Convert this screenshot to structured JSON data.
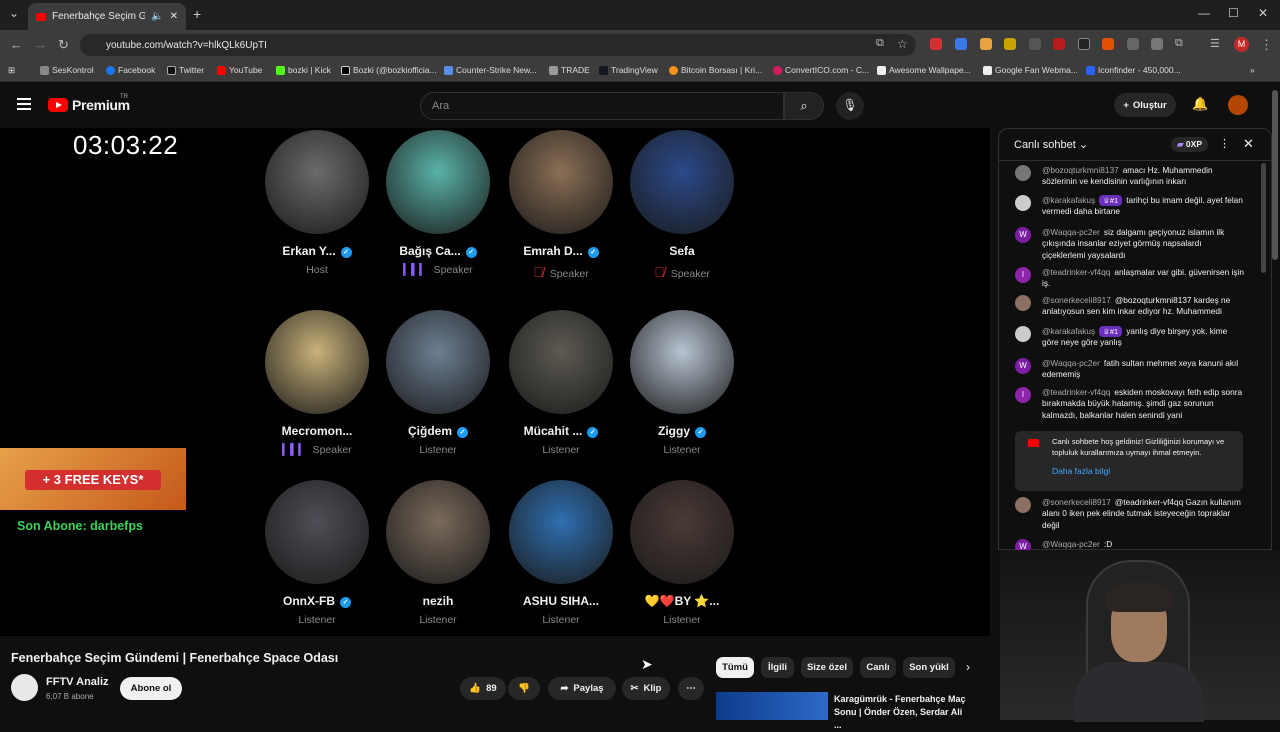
{
  "browser": {
    "tab_title": "Fenerbahçe Seçim Gündem",
    "url": "youtube.com/watch?v=hlkQLk6UpTI",
    "profile_initial": "M",
    "bookmarks": [
      "SesKontrol",
      "Facebook",
      "Twitter",
      "YouTube",
      "bozki | Kick",
      "Bozki (@bozkiofficia...",
      "Counter-Strike New...",
      "TRADE",
      "TradingView",
      "Bitcoin Borsası | Kri...",
      "ConvertICO.com - C...",
      "Awesome Wallpape...",
      "Google Fan Webma...",
      "Iconfinder - 450,000..."
    ]
  },
  "header": {
    "logo_text": "Premium",
    "logo_country": "TR",
    "search_placeholder": "Ara",
    "create_label": "Oluştur"
  },
  "player": {
    "timer": "03:03:22",
    "promo_text": "+ 3 FREE KEYS*",
    "last_sub": "Son Abone: darbefps",
    "participants": [
      {
        "name": "Erkan Y...",
        "role": "Host",
        "verified": true,
        "status": "none",
        "color": "#6b6b6b"
      },
      {
        "name": "Bağış Ca...",
        "role": "Speaker",
        "verified": true,
        "status": "talking",
        "color": "#5ab3a8"
      },
      {
        "name": "Emrah D...",
        "role": "Speaker",
        "verified": true,
        "status": "muted",
        "color": "#8a6f55"
      },
      {
        "name": "Sefa",
        "role": "Speaker",
        "verified": false,
        "status": "muted",
        "color": "#2b4a8a"
      },
      {
        "name": "Mecromon...",
        "role": "Speaker",
        "verified": false,
        "status": "talking",
        "color": "#c9b27a"
      },
      {
        "name": "Çiğdem",
        "role": "Listener",
        "verified": true,
        "status": "none",
        "color": "#6d7f93"
      },
      {
        "name": "Mücahit ...",
        "role": "Listener",
        "verified": true,
        "status": "none",
        "color": "#5d5a52"
      },
      {
        "name": "Ziggy",
        "role": "Listener",
        "verified": true,
        "status": "none",
        "color": "#b8c4d2"
      },
      {
        "name": "OnnX-FB",
        "role": "Listener",
        "verified": true,
        "status": "none",
        "color": "#4e4f56"
      },
      {
        "name": "nezih",
        "role": "Listener",
        "verified": false,
        "status": "none",
        "color": "#7a6a5c"
      },
      {
        "name": "ASHU SIHA...",
        "role": "Listener",
        "verified": false,
        "status": "none",
        "color": "#2f6fb0"
      },
      {
        "name": "💛❤️BY ⭐...",
        "role": "Listener",
        "verified": false,
        "status": "none",
        "color": "#4a3a36"
      }
    ]
  },
  "video": {
    "title": "Fenerbahçe Seçim Gündemi | Fenerbahçe Space Odası",
    "channel": "FFTV Analiz",
    "subs": "6,07 B abone",
    "subscribe": "Abone ol",
    "likes": "89",
    "share": "Paylaş",
    "clip": "Klip"
  },
  "chips": [
    "Tümü",
    "İlgili",
    "Size özel",
    "Canlı",
    "Son yükl"
  ],
  "recommended": {
    "title": "Karagümrük - Fenerbahçe Maç Sonu | Önder Özen, Serdar Ali ..."
  },
  "chat": {
    "title": "Canlı sohbet",
    "xp": "0XP",
    "messages": [
      {
        "author": "@bozoqturkmni8137",
        "badge": "",
        "text": "amacı Hz. Muhammedin sözlerinin ve kendisinin varlığının inkarı",
        "initial": "",
        "color": "#777"
      },
      {
        "author": "@karakafakuş",
        "badge": "#1",
        "text": "tarihçi bu imam değil. ayet felan vermedi daha birtane",
        "initial": "",
        "color": "#ccc"
      },
      {
        "author": "@Waqqa-pc2er",
        "badge": "",
        "text": "siz dalgamı geçiyonuz islamın ilk çıkışında insanlar eziyet görmüş napsalardı çiçeklerlemi yaysalardı",
        "initial": "W",
        "color": "#7b1fa2"
      },
      {
        "author": "@teadrinker-vf4qq",
        "badge": "",
        "text": "anlaşmalar var gibi. güvenirsen işin iş.",
        "initial": "I",
        "color": "#8e24aa"
      },
      {
        "author": "@sonerkeceli8917",
        "badge": "",
        "text": "@bozoqturkmni8137 kardeş ne anlatıyosun sen kim inkar ediyor hz. Muhammedi",
        "initial": "",
        "color": "#8a7060"
      },
      {
        "author": "@karakafakuş",
        "badge": "#1",
        "text": "yanlış diye birşey yok. kime göre neye göre yanlış",
        "initial": "",
        "color": "#ccc"
      },
      {
        "author": "@Waqqa-pc2er",
        "badge": "",
        "text": "fatih sultan mehmet xeya kanuni akıl edememiş",
        "initial": "W",
        "color": "#7b1fa2"
      },
      {
        "author": "@teadrinker-vf4qq",
        "badge": "",
        "text": "eskiden moskovayı feth edip sonra bırakmakda büyük hatamış. şimdi gaz sorunun kalmazdı, balkanlar halen senindi yani",
        "initial": "I",
        "color": "#8e24aa"
      },
      {
        "author": "@sonerkeceli8917",
        "badge": "",
        "text": "@teadrinker-vf4qq Gazın kullanım alanı 0 iken pek elinde tutmak isteyeceğin topraklar değil",
        "initial": "",
        "color": "#8a7060"
      },
      {
        "author": "@Waqqa-pc2er",
        "badge": "",
        "text": ":D",
        "initial": "W",
        "color": "#7b1fa2"
      }
    ],
    "welcome_text": "Canlı sohbete hoş geldiniz! Gizliliğinizi korumayı ve topluluk kurallarımıza uymayı ihmal etmeyin.",
    "welcome_link": "Daha fazla bilgi"
  }
}
